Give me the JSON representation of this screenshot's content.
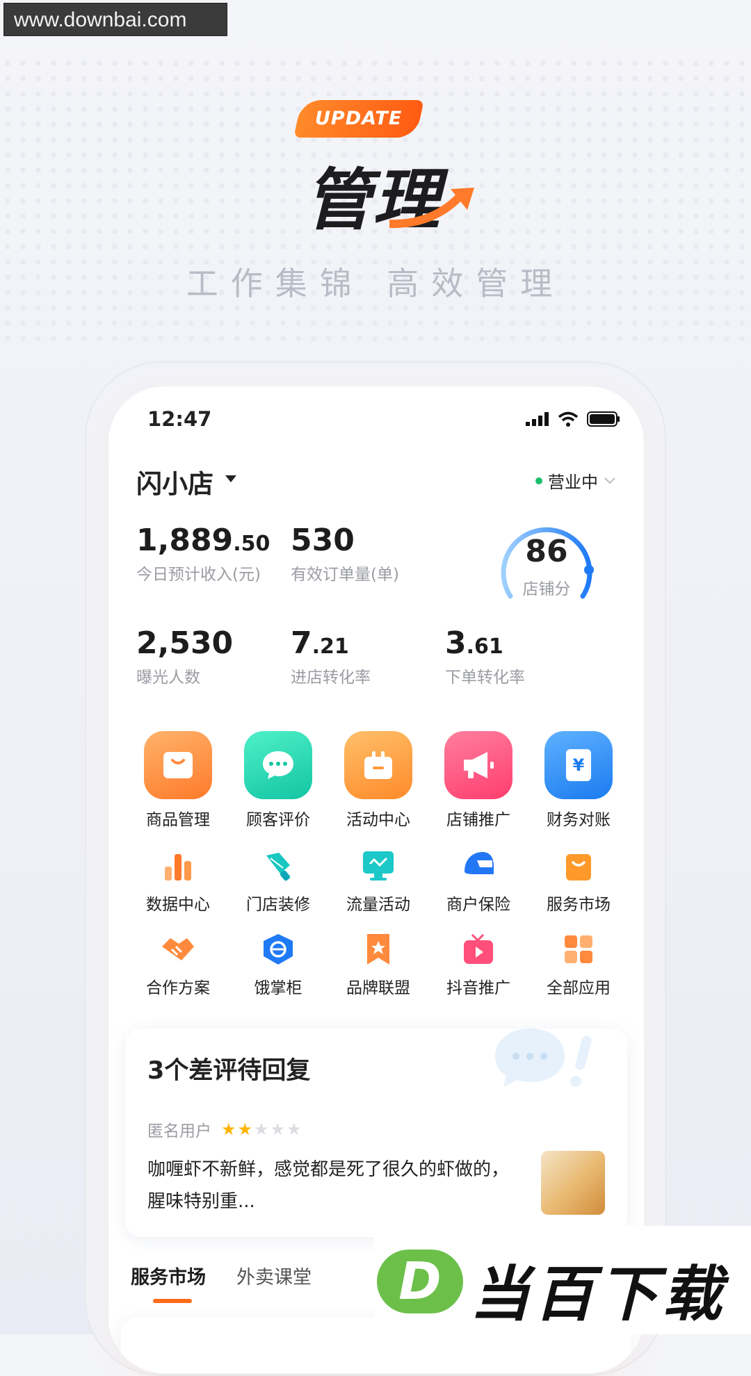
{
  "watermark_top": "www.downbai.com",
  "hero": {
    "badge": "UPDATE",
    "title": "管理",
    "subtitle": "工作集锦  高效管理"
  },
  "phone": {
    "status_bar": {
      "time": "12:47"
    },
    "shop": {
      "name": "闪小店",
      "status": "营业中"
    },
    "metrics": [
      {
        "value_main": "1,889",
        "value_dec": ".50",
        "label": "今日预计收入(元)"
      },
      {
        "value_main": "530",
        "value_dec": "",
        "label": "有效订单量(单)"
      },
      {
        "value_main": "2,530",
        "value_dec": "",
        "label": "曝光人数"
      },
      {
        "value_main": "7",
        "value_dec": ".21",
        "label": "进店转化率"
      },
      {
        "value_main": "3",
        "value_dec": ".61",
        "label": "下单转化率"
      }
    ],
    "store_score": {
      "value": "86",
      "label": "店铺分",
      "gauge_fraction": 0.86
    },
    "primary_apps": [
      {
        "label": "商品管理",
        "icon": "shopping-bag-icon",
        "color": "#ff8a3d"
      },
      {
        "label": "顾客评价",
        "icon": "chat-bubble-icon",
        "color": "#26d3b1"
      },
      {
        "label": "活动中心",
        "icon": "gift-box-icon",
        "color": "#ff9a3a"
      },
      {
        "label": "店铺推广",
        "icon": "megaphone-icon",
        "color": "#ff4f7a"
      },
      {
        "label": "财务对账",
        "icon": "yuan-ledger-icon",
        "color": "#2f8dfa"
      }
    ],
    "secondary_apps": [
      {
        "label": "数据中心",
        "icon": "bar-chart-icon"
      },
      {
        "label": "门店装修",
        "icon": "paint-brush-icon"
      },
      {
        "label": "流量活动",
        "icon": "monitor-icon"
      },
      {
        "label": "商户保险",
        "icon": "helmet-icon"
      },
      {
        "label": "服务市场",
        "icon": "shop-bag-icon"
      },
      {
        "label": "合作方案",
        "icon": "handshake-icon"
      },
      {
        "label": "饿掌柜",
        "icon": "eleme-shield-icon"
      },
      {
        "label": "品牌联盟",
        "icon": "bookmark-star-icon"
      },
      {
        "label": "抖音推广",
        "icon": "tv-play-icon"
      },
      {
        "label": "全部应用",
        "icon": "grid-apps-icon"
      }
    ],
    "review": {
      "title": "3个差评待回复",
      "user": "匿名用户",
      "rating": 2,
      "rating_max": 5,
      "text": "咖喱虾不新鲜，感觉都是死了很久的虾做的，腥味特别重..."
    },
    "tabs": [
      "服务市场",
      "外卖课堂"
    ]
  },
  "brand_watermark": {
    "letter": "D",
    "text": "当百下载"
  }
}
